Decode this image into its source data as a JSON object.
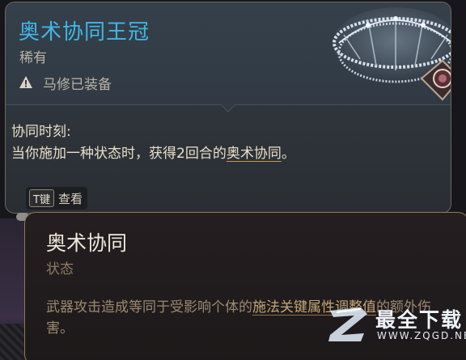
{
  "item": {
    "title": "奥术协同王冠",
    "rarity": "稀有",
    "equipped_status": "马修已装备",
    "passive_name": "协同时刻:",
    "passive_desc_before": "当你施加一种状态时，获得2回合的",
    "passive_keyword": "奥术协同",
    "passive_desc_after": "。"
  },
  "view_hint": {
    "key": "T键",
    "label": "查看"
  },
  "status": {
    "title": "奥术协同",
    "type": "状态",
    "desc_before": "武器攻击造成等同于受影响个体的",
    "desc_keyword": "施法关键属性调整值",
    "desc_after": "的额外伤害。"
  },
  "watermark": {
    "name": "最全下载",
    "url": "WWW.ZQGD.NET"
  },
  "colors": {
    "item_title": "#41b7e6",
    "status_border": "#8d7a58",
    "keyword_underline": "#c79a47"
  }
}
